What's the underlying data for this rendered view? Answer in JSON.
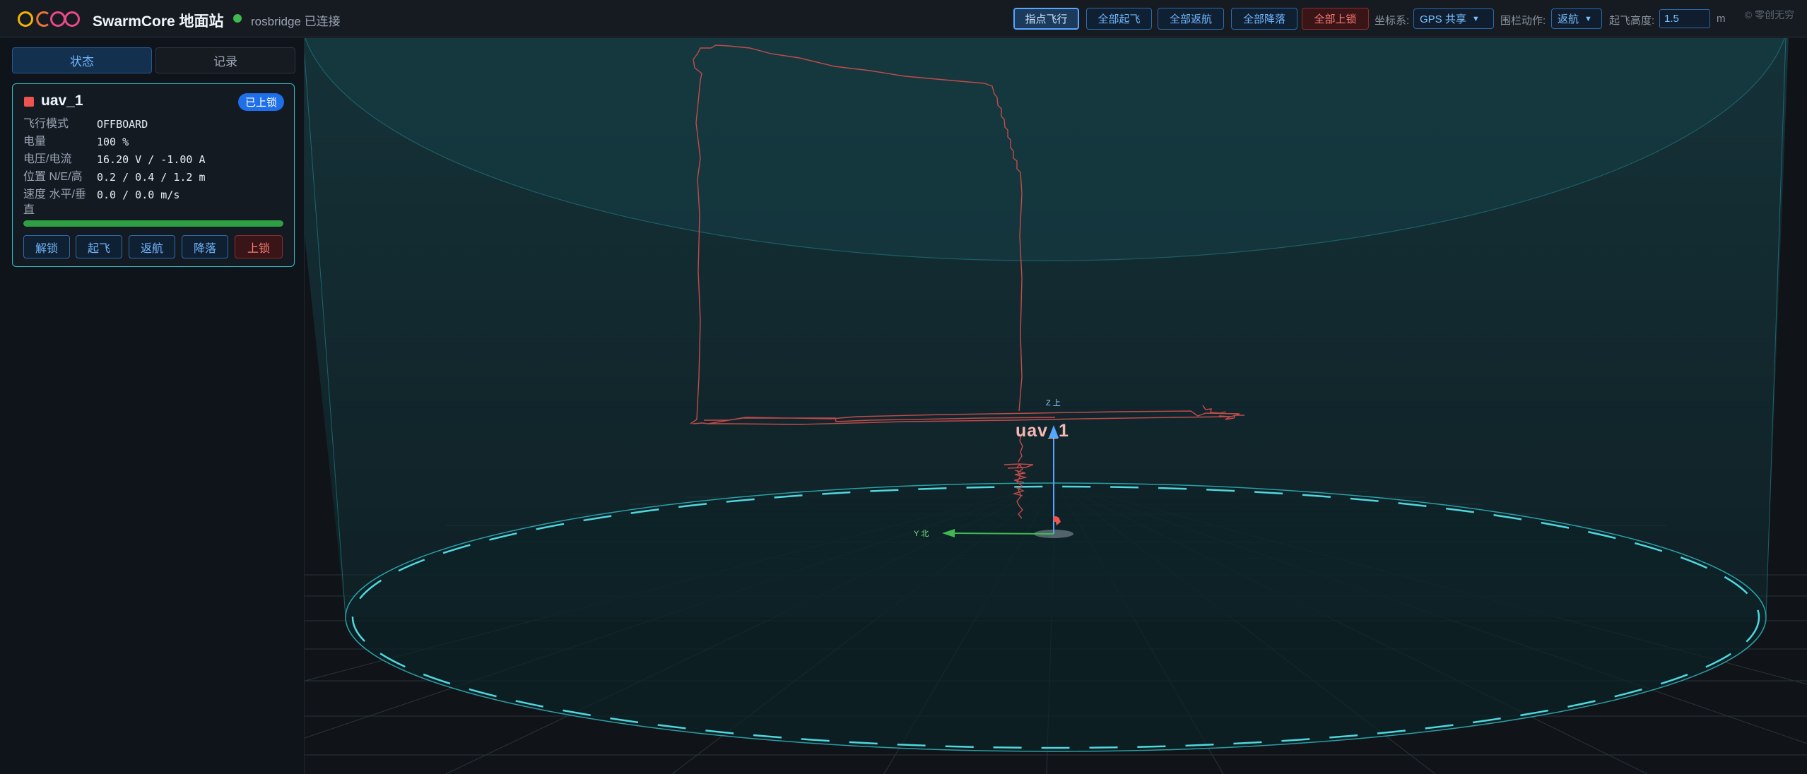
{
  "header": {
    "app_title": "SwarmCore 地面站",
    "connection_status": "rosbridge 已连接",
    "buttons": {
      "point_fly": "指点飞行",
      "all_takeoff": "全部起飞",
      "all_return": "全部返航",
      "all_land": "全部降落",
      "all_lock": "全部上锁"
    },
    "coord_label": "坐标系:",
    "coord_value": "GPS 共享",
    "fence_label": "围栏动作:",
    "fence_value": "返航",
    "takeoff_alt_label": "起飞高度:",
    "takeoff_alt_value": "1.5",
    "takeoff_alt_unit": "m",
    "copyright": "© 零创无穷"
  },
  "sidebar": {
    "tabs": [
      "状态",
      "记录"
    ],
    "uav": {
      "name": "uav_1",
      "badge": "已上锁",
      "fields": [
        {
          "label": "飞行模式",
          "value": "OFFBOARD"
        },
        {
          "label": "电量",
          "value": "100 %"
        },
        {
          "label": "电压/电流",
          "value": "16.20 V / -1.00 A"
        },
        {
          "label": "位置 N/E/高",
          "value": "0.2 / 0.4 / 1.2 m"
        },
        {
          "label": "速度 水平/垂直",
          "value": "0.0 / 0.0 m/s"
        }
      ],
      "battery_percent": 100,
      "actions": {
        "unlock": "解锁",
        "takeoff": "起飞",
        "return": "返航",
        "land": "降落",
        "lock": "上锁"
      }
    }
  },
  "viewport": {
    "uav_label": "uav_1",
    "axis_z_label": "Z 上",
    "axis_y_label": "Y 北"
  },
  "colors": {
    "accent": "#58a6ff",
    "fence": "#2fbfc7",
    "trail": "#c24b4b",
    "ok": "#3fb950",
    "danger": "#ff7b72"
  }
}
